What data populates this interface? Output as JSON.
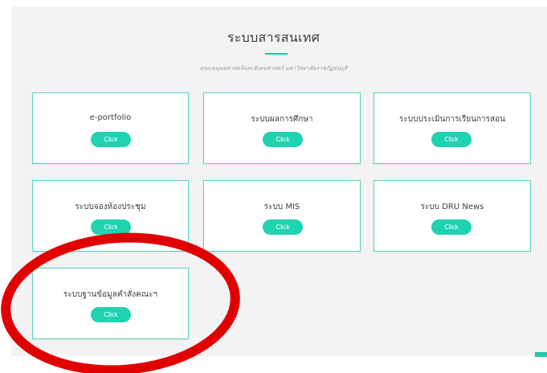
{
  "section": {
    "title": "ระบบสารสนเทศ",
    "subtitle": "คณะมนุษยศาสตร์และสังคมศาสตร์ มหาวิทยาลัยราชภัฏธนบุรี"
  },
  "cards": [
    {
      "title": "e-portfolio",
      "button_label": "Click"
    },
    {
      "title": "ระบบผลการศึกษา",
      "button_label": "Click"
    },
    {
      "title": "ระบบประเมินการเรียนการสอน",
      "button_label": "Click"
    },
    {
      "title": "ระบบจองห้องประชุม",
      "button_label": "Click"
    },
    {
      "title": "ระบบ MIS",
      "button_label": "Click"
    },
    {
      "title": "ระบบ DRU News",
      "button_label": "Click"
    },
    {
      "title": "ระบบฐานข้อมูลคำสั่งคณะฯ",
      "button_label": "Click"
    }
  ],
  "colors": {
    "accent": "#22c7a7",
    "button": "#1fd2b0",
    "card_border": "#5ad1c1",
    "highlight_circle": "#e00000"
  }
}
